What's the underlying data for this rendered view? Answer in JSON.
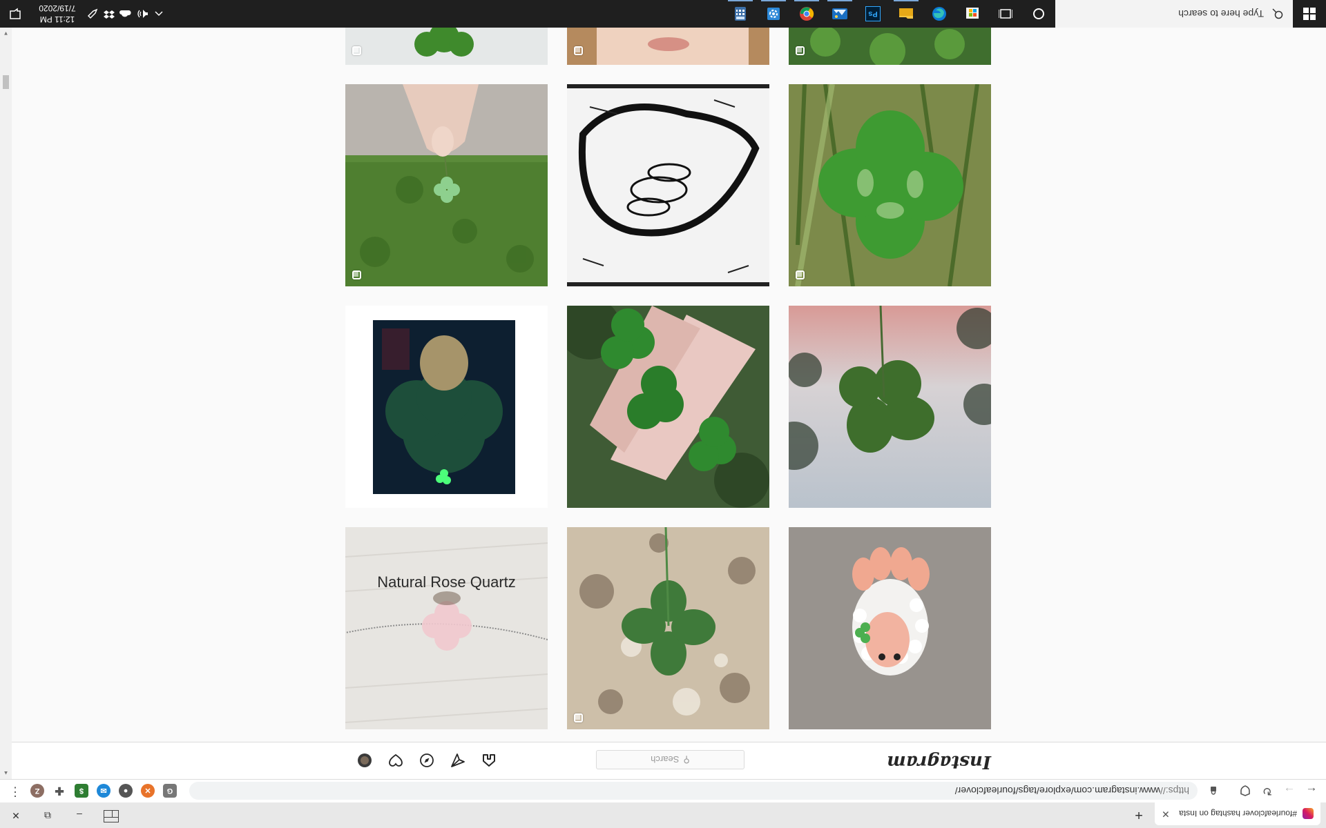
{
  "browser": {
    "tab_title": "#fourleafclover hashtag on Insta",
    "tab_close": "✕",
    "new_tab": "+",
    "window_controls": {
      "minimize": "–",
      "restore": "⧉",
      "close": "✕"
    },
    "back": "←",
    "forward": "→",
    "reload": "↻",
    "url_scheme": "https://",
    "url_rest": "www.instagram.com/explore/tags/fourleafclover/",
    "profile_letter": "Z",
    "menu": "⋮"
  },
  "instagram": {
    "logo": "Instagram",
    "search_icon": "⚲",
    "search_placeholder": "Search"
  },
  "posts": [
    {
      "name": "post-clover-sheep-figure",
      "multi": false,
      "art": "sheep"
    },
    {
      "name": "post-clover-on-granite",
      "multi": true,
      "art": "granite"
    },
    {
      "name": "post-rose-quartz-clover-necklace",
      "multi": false,
      "art": "necklace"
    },
    {
      "name": "post-clover-against-sky",
      "multi": false,
      "art": "sky"
    },
    {
      "name": "post-clovers-on-hand",
      "multi": false,
      "art": "hand"
    },
    {
      "name": "post-portrait-with-clover",
      "multi": false,
      "art": "portrait"
    },
    {
      "name": "post-clover-in-grass",
      "multi": true,
      "art": "grass"
    },
    {
      "name": "post-clover-ink-drawing",
      "multi": false,
      "art": "drawing"
    },
    {
      "name": "post-hand-holding-clover-lawn",
      "multi": true,
      "art": "lawn"
    }
  ],
  "necklace_caption": "Natural Rose Quartz",
  "taskbar": {
    "search_placeholder": "Type here to search",
    "app_label_ps": "Ps",
    "time": "12:11 PM",
    "date": "7/19/2020"
  },
  "colors": {
    "instagram_text": "#262626",
    "taskbar_bg": "#1f1f1f",
    "page_bg": "#fafafa"
  }
}
